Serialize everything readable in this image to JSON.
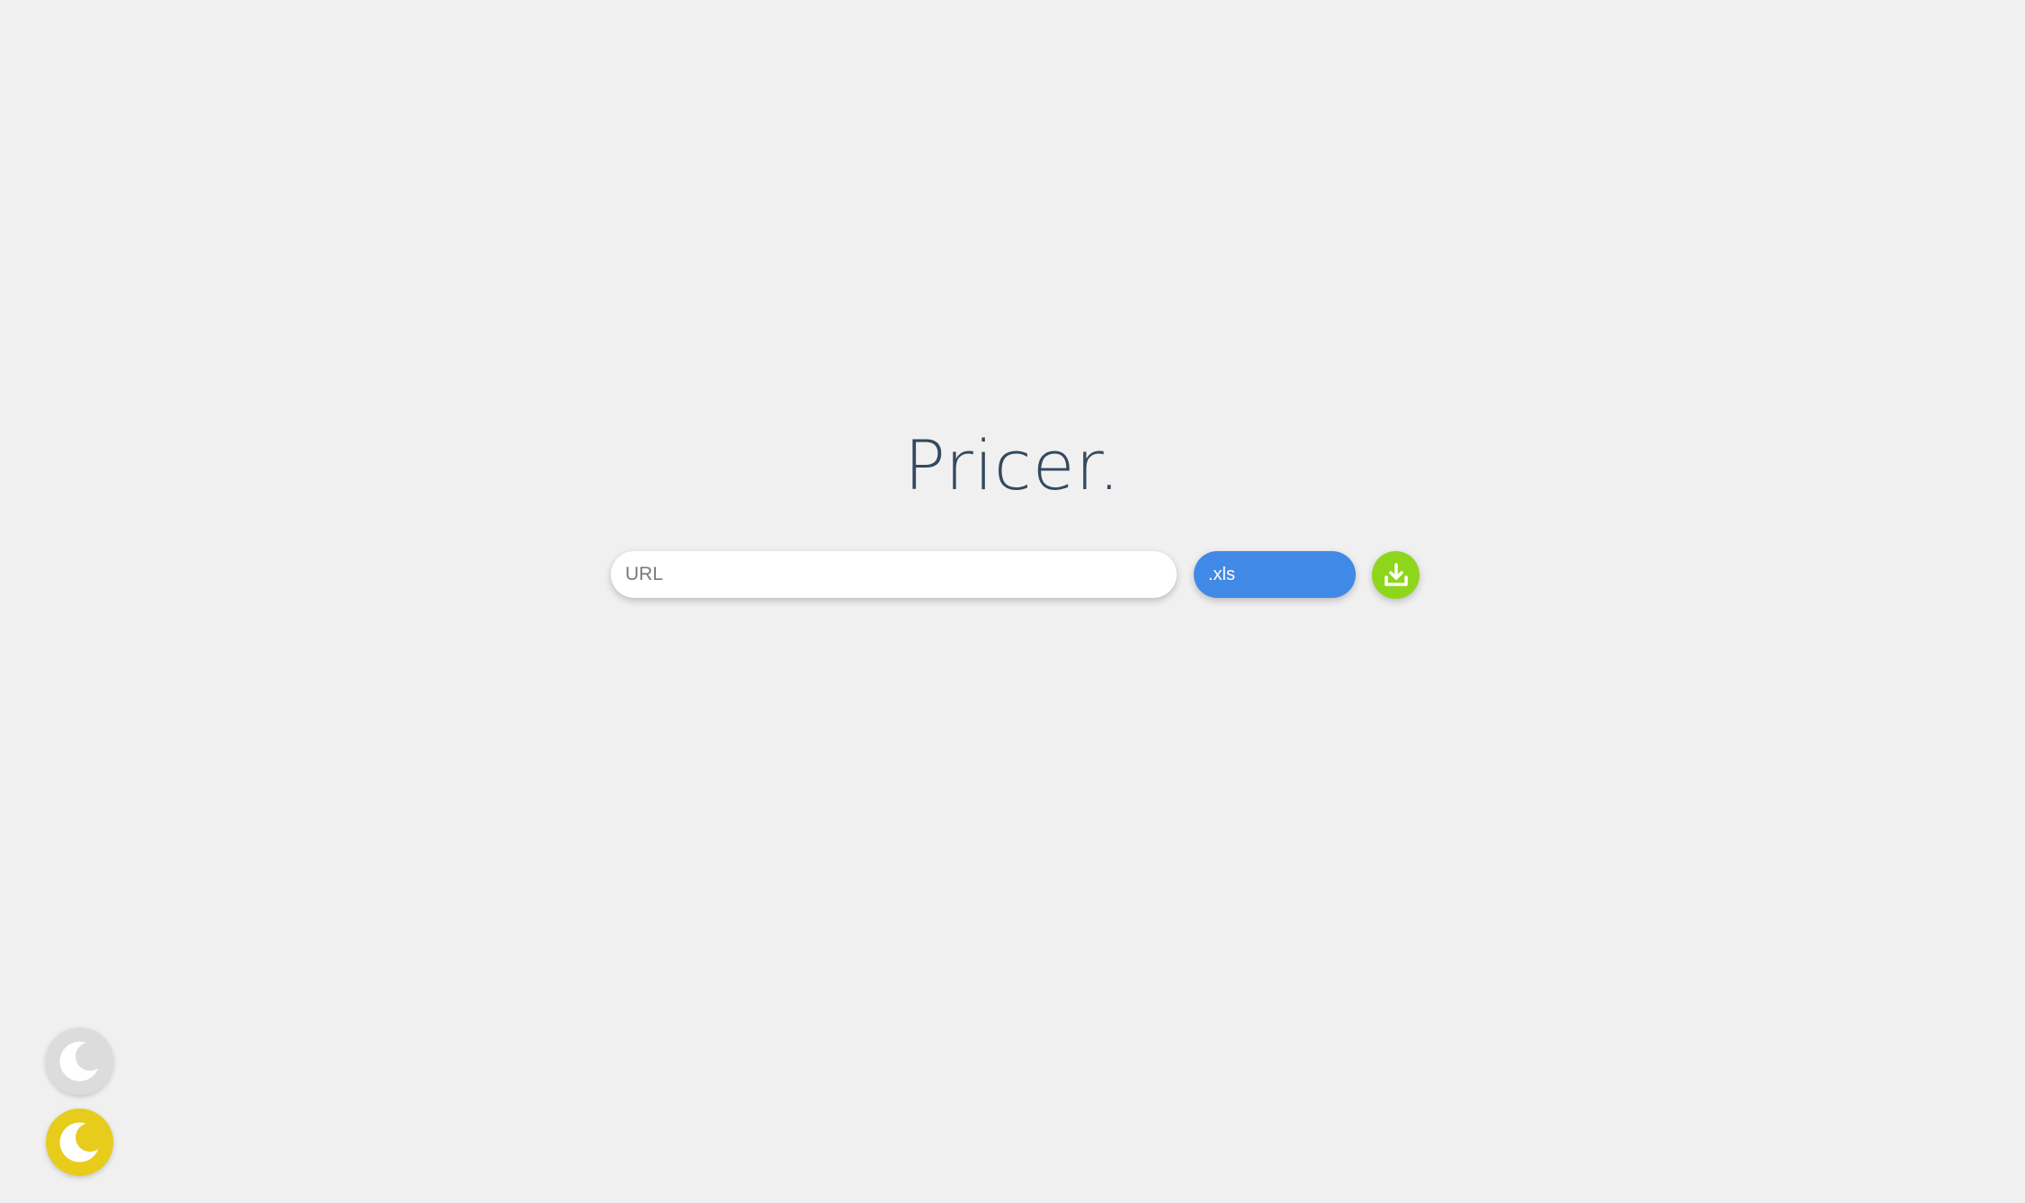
{
  "app": {
    "title": "Pricer."
  },
  "form": {
    "url_placeholder": "URL",
    "url_value": "",
    "format_selected": ".xls",
    "download_icon": "download-icon"
  },
  "theme": {
    "light_toggle_icon": "moon-icon",
    "dark_toggle_icon": "moon-icon"
  },
  "colors": {
    "background": "#f0f0f0",
    "title": "#34495e",
    "format_button": "#4189e6",
    "download_button": "#8ed61c",
    "light_toggle": "#dcdcdc",
    "dark_toggle": "#e8cc1c"
  }
}
